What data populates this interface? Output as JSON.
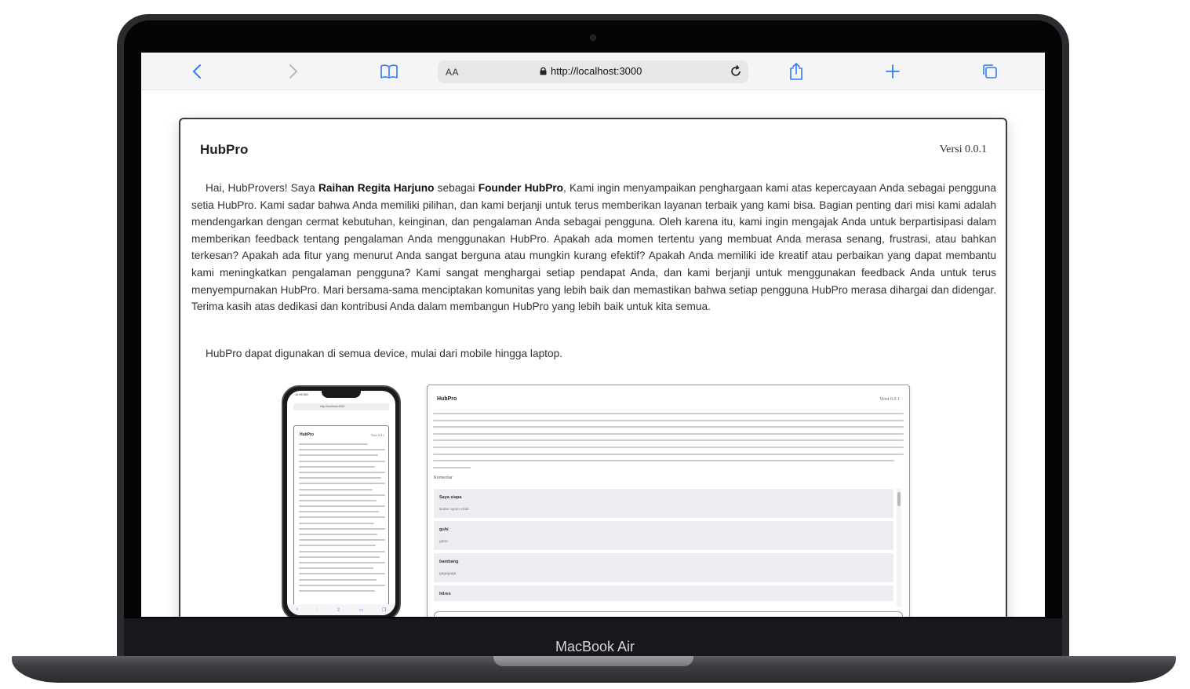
{
  "device": {
    "label": "MacBook Air"
  },
  "browser": {
    "address_prefix": "AA",
    "url": "http://localhost:3000"
  },
  "page": {
    "app_name": "HubPro",
    "version": "Versi 0.0.1",
    "intro": {
      "greeting": "Hai, HubProvers! Saya ",
      "founder_name": "Raihan Regita Harjuno",
      "as_text": " sebagai ",
      "founder_role": "Founder HubPro",
      "body": ", Kami ingin menyampaikan penghargaan kami atas kepercayaan Anda sebagai pengguna setia HubPro. Kami sadar bahwa Anda memiliki pilihan, dan kami berjanji untuk terus memberikan layanan terbaik yang kami bisa. Bagian penting dari misi kami adalah mendengarkan dengan cermat kebutuhan, keinginan, dan pengalaman Anda sebagai pengguna. Oleh karena itu, kami ingin mengajak Anda untuk berpartisipasi dalam memberikan feedback tentang pengalaman Anda menggunakan HubPro. Apakah ada momen tertentu yang membuat Anda merasa senang, frustrasi, atau bahkan terkesan? Apakah ada fitur yang menurut Anda sangat berguna atau mungkin kurang efektif? Apakah Anda memiliki ide kreatif atau perbaikan yang dapat membantu kami meningkatkan pengalaman pengguna? Kami sangat menghargai setiap pendapat Anda, dan kami berjanji untuk menggunakan feedback Anda untuk terus menyempurnakan HubPro. Mari bersama-sama menciptakan komunitas yang lebih baik dan memastikan bahwa setiap pengguna HubPro merasa dihargai dan didengar. Terima kasih atas dedikasi dan kontribusi Anda dalam membangun HubPro yang lebih baik untuk kita semua."
    },
    "device_note": "HubPro dapat digunakan di semua device, mulai dari mobile hingga laptop."
  },
  "phone_preview": {
    "status_time": "11:06 AM",
    "url": "http://localhost:3000",
    "title": "HubPro",
    "version": "Versi 0.0.1"
  },
  "desktop_preview": {
    "title": "HubPro",
    "version": "Versi 0.0.1",
    "comments_label": "Komentar",
    "comments": [
      {
        "name": "Saya siapa",
        "message": "Bubur ayam enak"
      },
      {
        "name": "guhi",
        "message": "gaha"
      },
      {
        "name": "bambang",
        "message": "gagagaga"
      },
      {
        "name": "hilres",
        "message": ""
      }
    ]
  }
}
